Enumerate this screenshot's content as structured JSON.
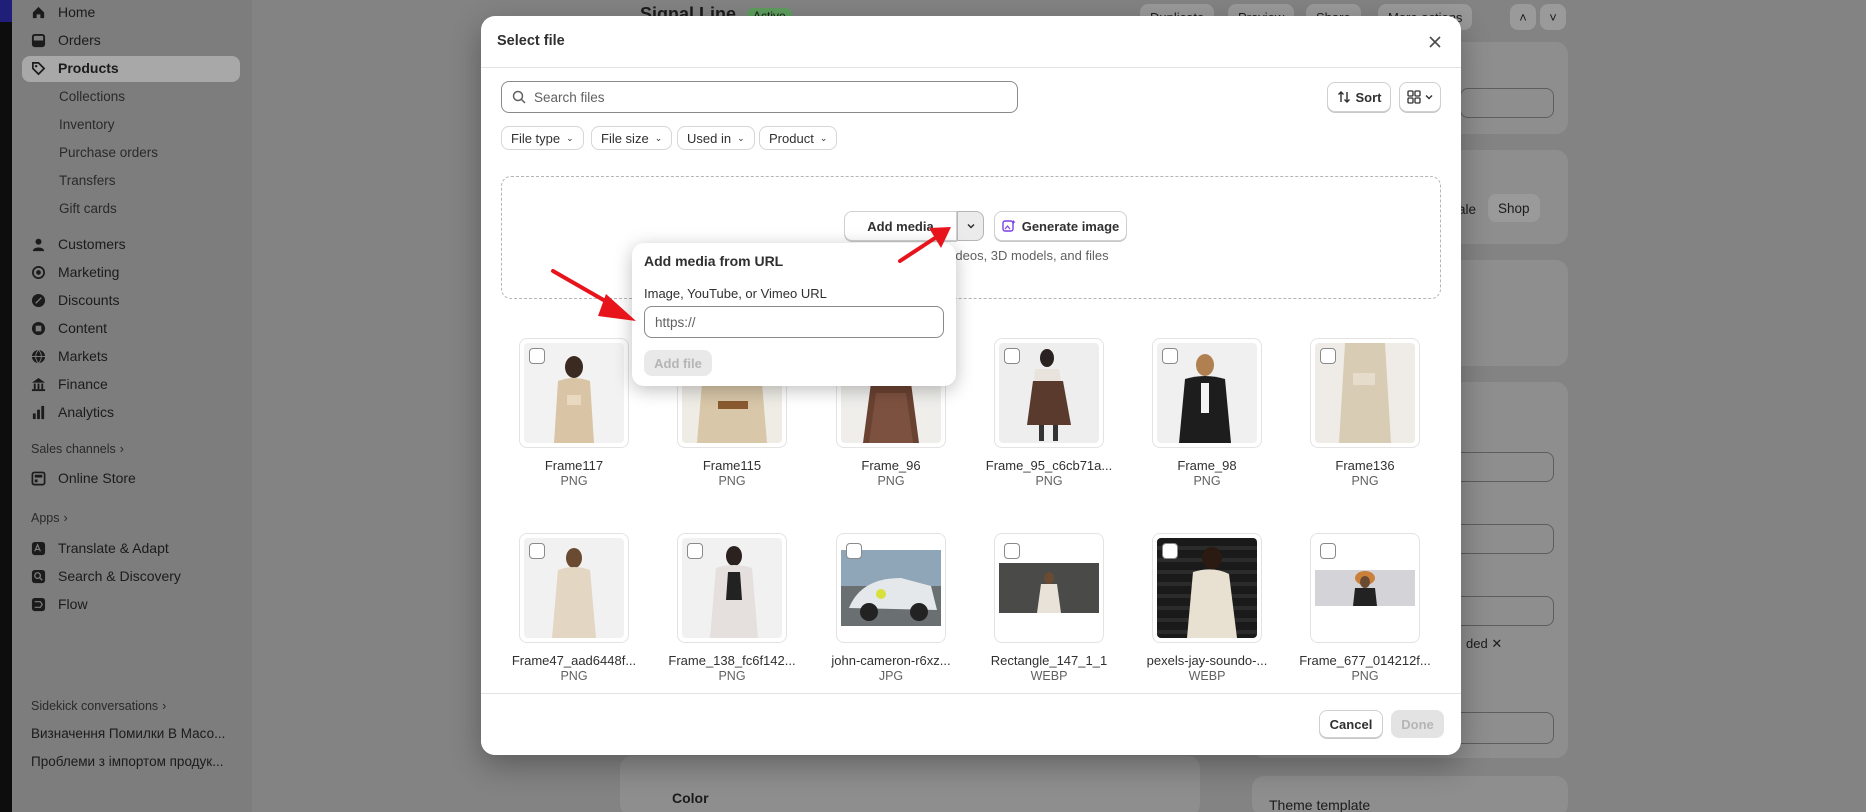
{
  "sidebar": {
    "items": [
      {
        "label": "Home",
        "icon": "home-icon"
      },
      {
        "label": "Orders",
        "icon": "orders-icon"
      },
      {
        "label": "Products",
        "icon": "tag-icon"
      }
    ],
    "product_sub": [
      "Collections",
      "Inventory",
      "Purchase orders",
      "Transfers",
      "Gift cards"
    ],
    "items2": [
      {
        "label": "Customers",
        "icon": "person-icon"
      },
      {
        "label": "Marketing",
        "icon": "target-icon"
      },
      {
        "label": "Discounts",
        "icon": "discount-icon"
      },
      {
        "label": "Content",
        "icon": "content-icon"
      },
      {
        "label": "Markets",
        "icon": "globe-icon"
      },
      {
        "label": "Finance",
        "icon": "bank-icon"
      },
      {
        "label": "Analytics",
        "icon": "bar-chart-icon"
      }
    ],
    "sales_channels_label": "Sales channels",
    "online_store": "Online Store",
    "apps_label": "Apps",
    "apps": [
      "Translate & Adapt",
      "Search & Discovery",
      "Flow"
    ],
    "sidekick_label": "Sidekick conversations",
    "conversations": [
      "Визначення Помилки В Масо...",
      "Проблеми з імпортом продук..."
    ]
  },
  "background": {
    "product_title": "Signal Line",
    "status_badge": "Active",
    "buttons": [
      "Duplicate",
      "Preview",
      "Share",
      "More actions"
    ],
    "tags_partial": [
      "ale",
      "Shop"
    ],
    "chip_partial": "ded",
    "color_label": "Color",
    "theme_template": "Theme template"
  },
  "modal": {
    "title": "Select file",
    "search_placeholder": "Search files",
    "sort_label": "Sort",
    "filters": [
      "File type",
      "File size",
      "Used in",
      "Product"
    ],
    "add_media_label": "Add media",
    "generate_image_label": "Generate image",
    "dropzone_hint": "videos, 3D models, and files",
    "cancel_label": "Cancel",
    "done_label": "Done",
    "files": [
      {
        "name": "Frame117",
        "type": "PNG"
      },
      {
        "name": "Frame115",
        "type": "PNG"
      },
      {
        "name": "Frame_96",
        "type": "PNG"
      },
      {
        "name": "Frame_95_c6cb71a...",
        "type": "PNG"
      },
      {
        "name": "Frame_98",
        "type": "PNG"
      },
      {
        "name": "Frame136",
        "type": "PNG"
      },
      {
        "name": "Frame47_aad6448f...",
        "type": "PNG"
      },
      {
        "name": "Frame_138_fc6f142...",
        "type": "PNG"
      },
      {
        "name": "john-cameron-r6xz...",
        "type": "JPG"
      },
      {
        "name": "Rectangle_147_1_1",
        "type": "WEBP"
      },
      {
        "name": "pexels-jay-soundo-...",
        "type": "WEBP"
      },
      {
        "name": "Frame_677_014212f...",
        "type": "PNG"
      }
    ]
  },
  "popover": {
    "title": "Add media from URL",
    "field_label": "Image, YouTube, or Vimeo URL",
    "field_placeholder": "https://",
    "add_file_label": "Add file"
  },
  "colors": {
    "annotation_arrow": "#e8141c",
    "accent_purple": "#7b3fe4"
  }
}
